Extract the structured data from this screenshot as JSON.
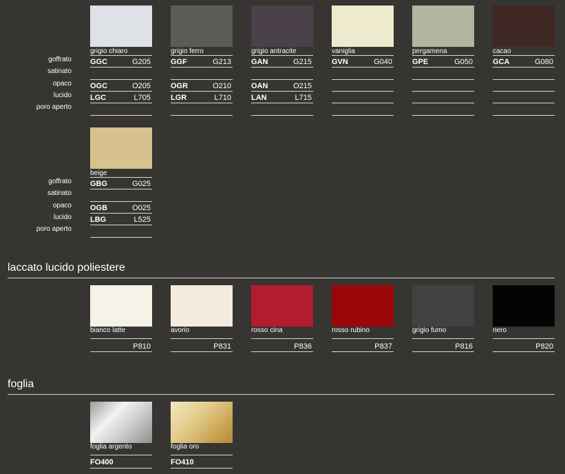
{
  "finish_labels": [
    "goffrato",
    "satinato",
    "opaco",
    "lucido",
    "poro aperto"
  ],
  "group1": [
    {
      "name": "grigio chiaro",
      "color": "#dee2e6",
      "codes": [
        [
          "GGC",
          "G205"
        ],
        [
          "",
          ""
        ],
        [
          "OGC",
          "O205"
        ],
        [
          "LGC",
          "L705"
        ],
        [
          "",
          ""
        ]
      ]
    },
    {
      "name": "grigio ferro",
      "color": "#5c5b58",
      "codes": [
        [
          "GGF",
          "G213"
        ],
        [
          "",
          ""
        ],
        [
          "OGR",
          "O210"
        ],
        [
          "LGR",
          "L710"
        ],
        [
          "",
          ""
        ]
      ]
    },
    {
      "name": "grigio antracite",
      "color": "#4a4248",
      "codes": [
        [
          "GAN",
          "G215"
        ],
        [
          "",
          ""
        ],
        [
          "OAN",
          "O215"
        ],
        [
          "LAN",
          "L715"
        ],
        [
          "",
          ""
        ]
      ]
    },
    {
      "name": "vaniglia",
      "color": "#eeeacd",
      "codes": [
        [
          "GVN",
          "G040"
        ],
        [
          "",
          ""
        ],
        [
          "",
          ""
        ],
        [
          "",
          ""
        ],
        [
          "",
          ""
        ]
      ]
    },
    {
      "name": "pergamena",
      "color": "#b4b5a0",
      "codes": [
        [
          "GPE",
          "G050"
        ],
        [
          "",
          ""
        ],
        [
          "",
          ""
        ],
        [
          "",
          ""
        ],
        [
          "",
          ""
        ]
      ]
    },
    {
      "name": "cacao",
      "color": "#3f2724",
      "codes": [
        [
          "GCA",
          "G080"
        ],
        [
          "",
          ""
        ],
        [
          "",
          ""
        ],
        [
          "",
          ""
        ],
        [
          "",
          ""
        ]
      ]
    }
  ],
  "group2": [
    {
      "name": "beige",
      "color": "#d7c18c",
      "codes": [
        [
          "GBG",
          "G025"
        ],
        [
          "",
          ""
        ],
        [
          "OGB",
          "O025"
        ],
        [
          "LBG",
          "L525"
        ],
        [
          "",
          ""
        ]
      ]
    }
  ],
  "section_lucido": {
    "title": "laccato lucido poliestere",
    "items": [
      {
        "name": "bianco latte",
        "color": "#f5f3e8",
        "code": "P810"
      },
      {
        "name": "avorio",
        "color": "#f3ebdd",
        "code": "P831"
      },
      {
        "name": "rosso cina",
        "color": "#b31c2d",
        "code": "P836"
      },
      {
        "name": "rosso rubino",
        "color": "#9a0609",
        "code": "P837"
      },
      {
        "name": "grigio fumo",
        "color": "#434043",
        "code": "P816"
      },
      {
        "name": "nero",
        "color": "#050405",
        "code": "P820"
      }
    ]
  },
  "section_foglia": {
    "title": "foglia",
    "items": [
      {
        "name": "foglia argento",
        "code": "FO400"
      },
      {
        "name": "foglia oro",
        "code": "FO410"
      }
    ]
  }
}
